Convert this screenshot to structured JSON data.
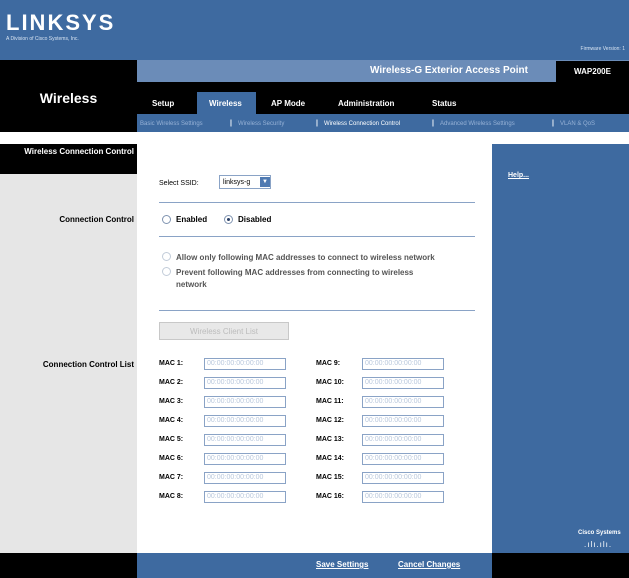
{
  "brand": {
    "logo": "LINKSYS",
    "subtitle": "A Division of Cisco Systems, Inc.",
    "firmware": "Firmware Version: 1"
  },
  "product": {
    "name": "Wireless-G Exterior Access Point",
    "model": "WAP200E"
  },
  "section_title": "Wireless",
  "menu": {
    "tabs": [
      {
        "label": "Setup"
      },
      {
        "label": "Wireless"
      },
      {
        "label": "AP Mode"
      },
      {
        "label": "Administration"
      },
      {
        "label": "Status"
      }
    ],
    "active_tab": "Wireless"
  },
  "submenu": [
    {
      "label": "Basic Wireless Settings"
    },
    {
      "label": "Wireless Security"
    },
    {
      "label": "Wireless Connection Control"
    },
    {
      "label": "Advanced Wireless Settings"
    },
    {
      "label": "VLAN & QoS"
    }
  ],
  "left": {
    "title": "Wireless Connection Control",
    "connection_control_label": "Connection Control",
    "connection_control_list_label": "Connection Control List"
  },
  "form": {
    "ssid_label": "Select SSID:",
    "ssid_value": "linksys-g",
    "enabled_label": "Enabled",
    "disabled_label": "Disabled",
    "selected_mode": "Disabled",
    "allow_label": "Allow only following MAC addresses to connect to wireless network",
    "prevent_label_1": "Prevent following MAC addresses from connecting to wireless",
    "prevent_label_2": "network",
    "client_list_button": "Wireless Client List",
    "mac_placeholder": "00:00:00:00:00:00",
    "macs_left": [
      {
        "label": "MAC 1:",
        "value": "00:00:00:00:00:00"
      },
      {
        "label": "MAC 2:",
        "value": "00:00:00:00:00:00"
      },
      {
        "label": "MAC 3:",
        "value": "00:00:00:00:00:00"
      },
      {
        "label": "MAC 4:",
        "value": "00:00:00:00:00:00"
      },
      {
        "label": "MAC 5:",
        "value": "00:00:00:00:00:00"
      },
      {
        "label": "MAC 6:",
        "value": "00:00:00:00:00:00"
      },
      {
        "label": "MAC 7:",
        "value": "00:00:00:00:00:00"
      },
      {
        "label": "MAC 8:",
        "value": "00:00:00:00:00:00"
      }
    ],
    "macs_right": [
      {
        "label": "MAC 9:",
        "value": "00:00:00:00:00:00"
      },
      {
        "label": "MAC 10:",
        "value": "00:00:00:00:00:00"
      },
      {
        "label": "MAC 11:",
        "value": "00:00:00:00:00:00"
      },
      {
        "label": "MAC 12:",
        "value": "00:00:00:00:00:00"
      },
      {
        "label": "MAC 13:",
        "value": "00:00:00:00:00:00"
      },
      {
        "label": "MAC 14:",
        "value": "00:00:00:00:00:00"
      },
      {
        "label": "MAC 15:",
        "value": "00:00:00:00:00:00"
      },
      {
        "label": "MAC 16:",
        "value": "00:00:00:00:00:00"
      }
    ]
  },
  "help": {
    "link": "Help..."
  },
  "footer": {
    "save": "Save Settings",
    "cancel": "Cancel Changes",
    "cisco": "Cisco Systems"
  },
  "colors": {
    "header_blue": "#3e6aa0",
    "product_bar": "#6b8cb8",
    "black": "#000000",
    "left_gray": "#e6e6e6"
  }
}
